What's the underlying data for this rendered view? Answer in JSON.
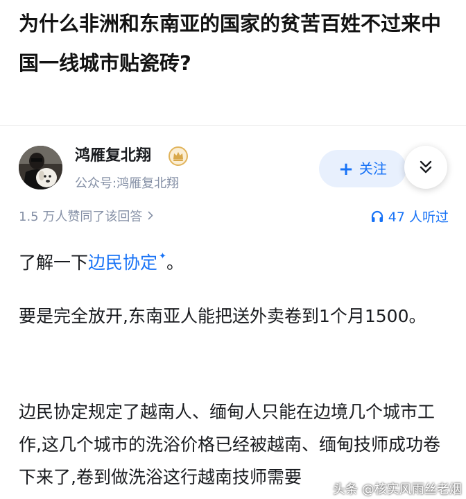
{
  "question": {
    "title": "为什么非洲和东南亚的国家的贫苦百姓不过来中国一线城市贴瓷砖?"
  },
  "author": {
    "name": "鸿雁复北翔",
    "subtitle": "公众号:鸿雁复北翔",
    "badge_icon": "crown-badge-icon"
  },
  "actions": {
    "follow_plus": "+",
    "follow_label": "关注",
    "expand_icon": "double-chevron-down-icon"
  },
  "meta": {
    "upvote_text": "1.5 万人赞同了该回答",
    "listen_text": "47 人听过",
    "listen_icon": "headphones-icon"
  },
  "answer": {
    "p1_before": "了解一下",
    "p1_link": "边民协定",
    "p1_spark": "✦",
    "p1_after": "。",
    "p2": "要是完全放开,东南亚人能把送外卖卷到1个月1500。",
    "p3": "边民协定规定了越南人、缅甸人只能在边境几个城市工作,这几个城市的洗浴价格已经被越南、缅甸技师成功卷下来了,卷到做洗浴这行越南技师需要"
  },
  "watermark": "头条 @核实风雨丝老烟",
  "colors": {
    "accent": "#1772f6",
    "follow_bg": "#e8f0fd",
    "meta_gray": "#8590a6",
    "badge_gold": "#d9a84a"
  }
}
